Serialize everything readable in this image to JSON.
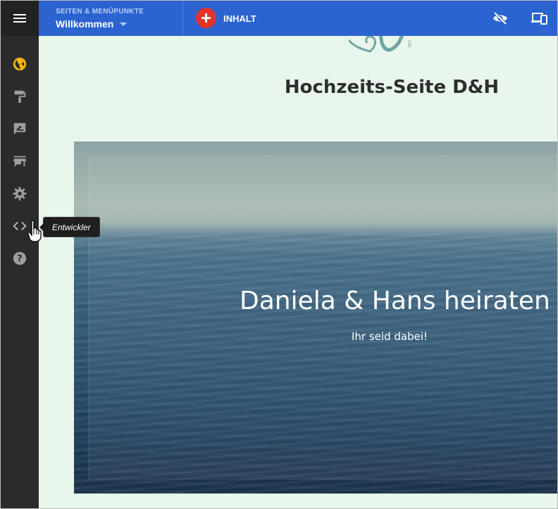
{
  "topbar": {
    "pages_kicker": "SEITEN & MENÜPUNKTE",
    "current_page": "Willkommen",
    "add_content_label": "INHALT"
  },
  "sidebar": {
    "items": [
      {
        "icon": "globe-icon"
      },
      {
        "icon": "paint-roller-icon"
      },
      {
        "icon": "edit-note-icon"
      },
      {
        "icon": "store-icon"
      },
      {
        "icon": "gear-icon"
      },
      {
        "icon": "code-icon",
        "tooltip": "Entwickler"
      },
      {
        "icon": "help-icon"
      }
    ]
  },
  "page": {
    "site_title": "Hochzeits-Seite D&H",
    "hero_headline": "Daniela & Hans heiraten",
    "hero_subline": "Ihr seid dabei!"
  },
  "colors": {
    "topbar": "#2b63d0",
    "sidebar": "#2b2b2b",
    "accent_yellow": "#f2b60f",
    "add_button": "#e2332b",
    "content_bg": "#e9f6ec"
  }
}
